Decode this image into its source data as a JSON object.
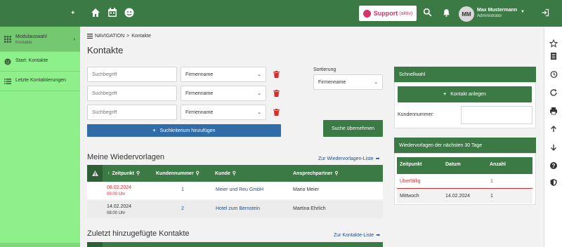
{
  "header": {
    "support_label": "Support",
    "support_status": "(aktiv)",
    "user_initials": "MM",
    "user_name": "Max Mustermann",
    "user_role": "Administrator"
  },
  "sidebar": {
    "module_title": "Modulauswahl",
    "module_sub": "Kontakte",
    "items": [
      {
        "label": "Start: Kontakte"
      },
      {
        "label": "Letzte Kontaktierungen"
      }
    ]
  },
  "breadcrumb": {
    "nav": "NAVIGATION",
    "sep": ">",
    "current": "Kontakte"
  },
  "page_title": "Kontakte",
  "search": {
    "rows": [
      {
        "placeholder": "Suchbegriff",
        "field": "Firmenname"
      },
      {
        "placeholder": "Suchbegriff",
        "field": "Firmenname"
      },
      {
        "placeholder": "Suchbegriff",
        "field": "Firmenname"
      }
    ],
    "add_label": "Suchkriterium hinzufügen",
    "sort_label": "Sortierung",
    "sort_value": "Firmenname",
    "apply_label": "Suche übernehmen"
  },
  "wiedervorlagen": {
    "title": "Meine Wiedervorlagen",
    "link": "Zur Wiedervorlagen-Liste",
    "columns": [
      "Zeitpunkt",
      "Kundennummer",
      "Kunde",
      "Ansprechpartner"
    ],
    "rows": [
      {
        "date": "08.02.2024",
        "time": "09:00 Uhr",
        "kundennummer": "1",
        "kunde": "Meier und Reu GmbH",
        "ansprechpartner": "Mario Meier",
        "overdue": true
      },
      {
        "date": "14.02.2024",
        "time": "08:00 Uhr",
        "kundennummer": "2",
        "kunde": "Hotel zum Bernstein",
        "ansprechpartner": "Martina Ehrlich",
        "overdue": false
      }
    ]
  },
  "zuletzt": {
    "title": "Zuletzt hinzugefügte Kontakte",
    "link": "Zur Kontakte-Liste"
  },
  "schnellwahl": {
    "title": "Schnellwahl",
    "create_label": "Kontakt anlegen",
    "kundennummer_label": "Kundennummer:"
  },
  "wv30": {
    "title": "Wiedervorlagen der nächsten 30 Tage",
    "columns": [
      "Zeitpunkt",
      "Datum",
      "Anzahl"
    ],
    "rows": [
      {
        "zeitpunkt": "Überfällig",
        "datum": "",
        "anzahl": "1",
        "overdue": true
      },
      {
        "zeitpunkt": "Mittwoch",
        "datum": "14.02.2024",
        "anzahl": "1",
        "overdue": false
      }
    ]
  },
  "colors": {
    "primary_green": "#3c7a45",
    "sidebar_green": "#8ef08a",
    "blue_button": "#2f6ca8",
    "alert_red": "#d32f2f",
    "support_pink": "#d6336c"
  }
}
